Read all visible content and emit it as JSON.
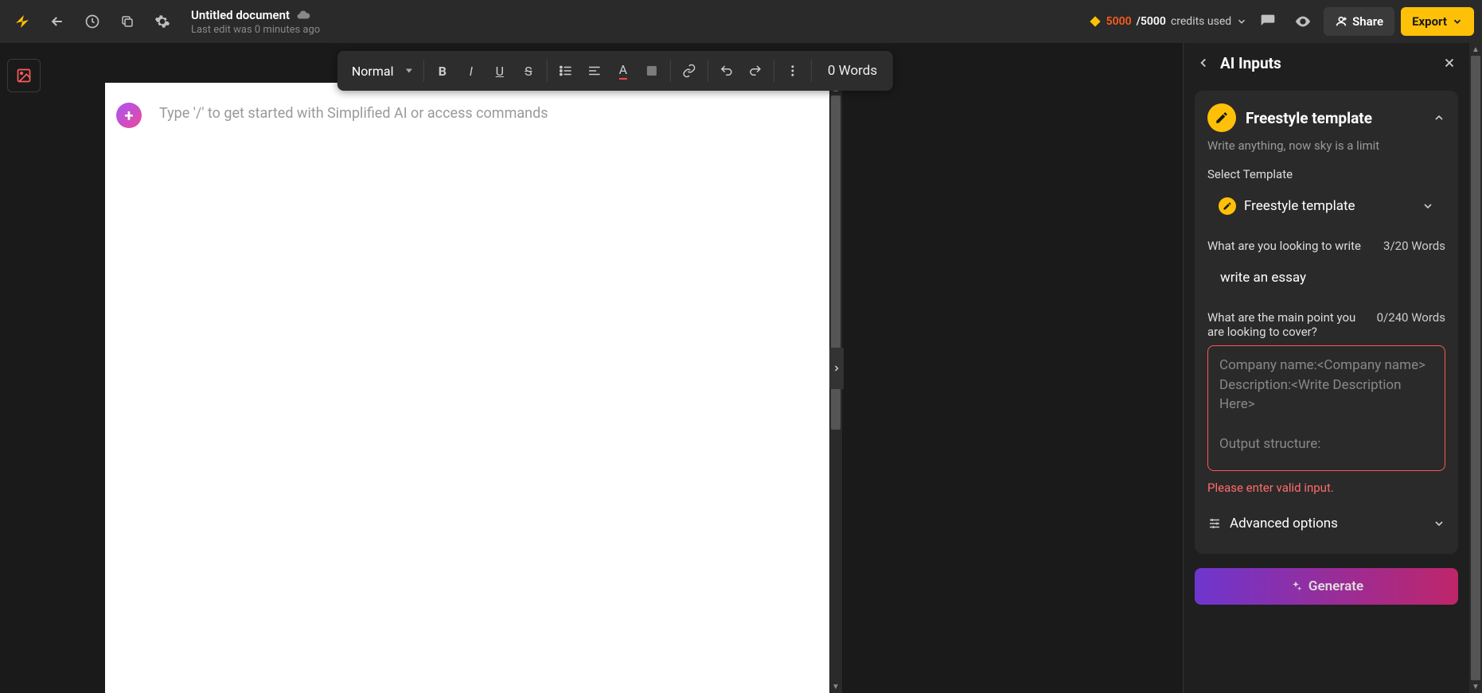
{
  "header": {
    "doc_title": "Untitled document",
    "doc_subtitle": "Last edit was 0 minutes ago",
    "credits_current": "5000",
    "credits_max": "/5000",
    "credits_label": "credits used",
    "share_label": "Share",
    "export_label": "Export"
  },
  "toolbar": {
    "style": "Normal",
    "word_count": "0 Words"
  },
  "editor": {
    "placeholder": "Type '/' to get started with Simplified AI or access commands"
  },
  "panel": {
    "title": "AI Inputs",
    "template_card": {
      "title": "Freestyle template",
      "subtitle": "Write anything, now sky is a limit"
    },
    "select_template_label": "Select Template",
    "select_template_value": "Freestyle template",
    "prompt_label": "What are you looking to write",
    "prompt_count": "3/20 Words",
    "prompt_value": "write an essay",
    "points_label": "What are the main point you are looking to cover?",
    "points_count": "0/240 Words",
    "points_placeholder": "Company name:<Company name>\nDescription:<Write Description Here>\n\nOutput structure:",
    "error": "Please enter valid input.",
    "advanced_label": "Advanced options",
    "generate_label": "Generate"
  }
}
